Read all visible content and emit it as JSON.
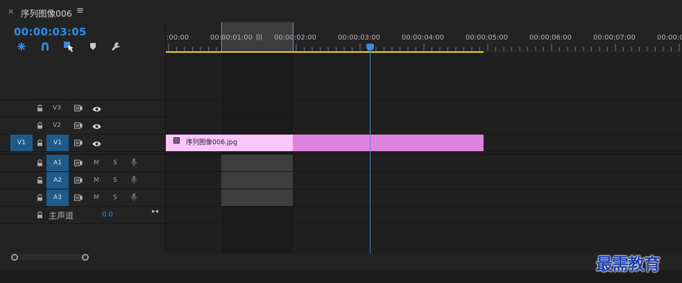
{
  "tab": {
    "close": "×",
    "title": "序列图像006",
    "menu": "≡"
  },
  "timecode": "00:00:03:05",
  "tools": [
    "snap-icon",
    "magnet-icon",
    "linked-selection-icon",
    "marker-icon",
    "wrench-icon"
  ],
  "ruler": {
    "labels": [
      ":00:00",
      "00:00:01:00",
      "00:00:02:00",
      "00:00:03:00",
      "00:00:04:00",
      "00:00:05:00",
      "00:00:06:00",
      "00:00:07:00",
      "00:00:0"
    ]
  },
  "tracks": {
    "video": [
      {
        "name": "V3",
        "source": "",
        "selected": false
      },
      {
        "name": "V2",
        "source": "",
        "selected": false
      },
      {
        "name": "V1",
        "source": "V1",
        "selected": true
      }
    ],
    "audio": [
      {
        "name": "A1",
        "m": "M",
        "s": "S",
        "selected": true
      },
      {
        "name": "A2",
        "m": "M",
        "s": "S",
        "selected": true
      },
      {
        "name": "A3",
        "m": "M",
        "s": "S",
        "selected": true
      }
    ],
    "master": {
      "label": "主声道",
      "value": "0.0",
      "end": "▸◂"
    }
  },
  "clip": {
    "name": "序列图像006.jpg"
  },
  "watermark": "最需教育",
  "colors": {
    "accent": "#2d8ceb",
    "clip": "#de83de",
    "clip_highlight": "#fbc6fb",
    "work_area": "#e8d92a"
  }
}
